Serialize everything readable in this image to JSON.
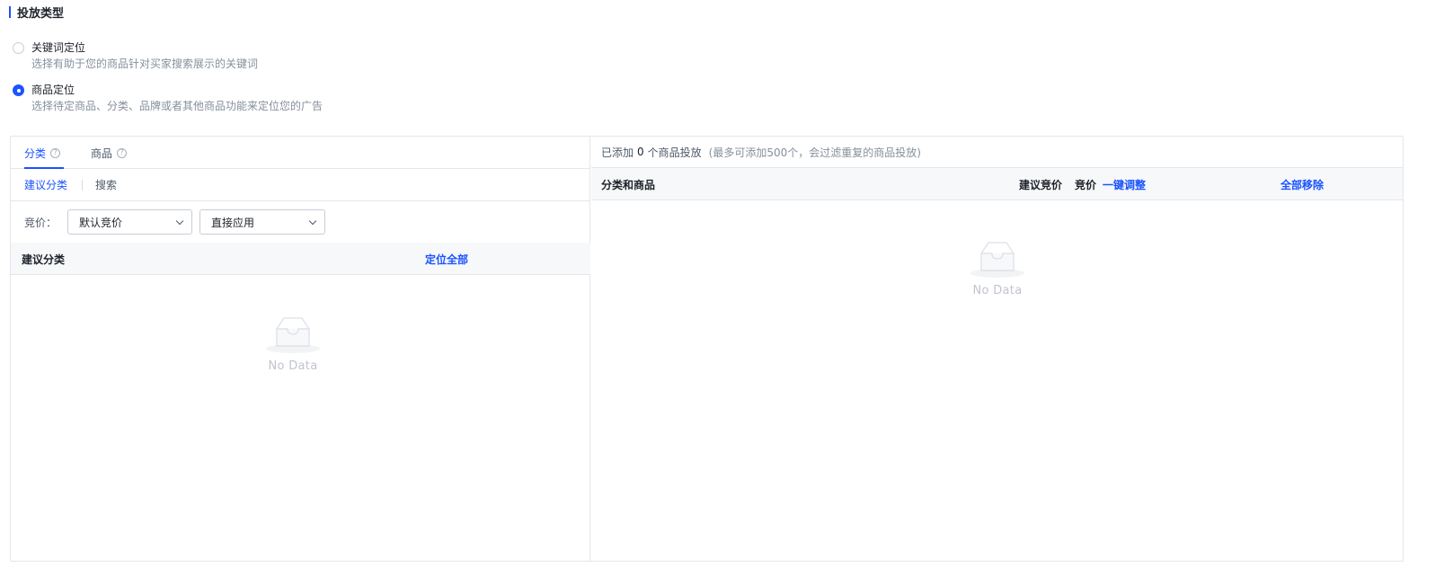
{
  "section": {
    "title": "投放类型"
  },
  "targeting_options": [
    {
      "label": "关键词定位",
      "desc": "选择有助于您的商品针对买家搜索展示的关键词",
      "checked": false
    },
    {
      "label": "商品定位",
      "desc": "选择待定商品、分类、品牌或者其他商品功能来定位您的广告",
      "checked": true
    }
  ],
  "left": {
    "tabs": [
      {
        "label": "分类",
        "help": "?",
        "active": true
      },
      {
        "label": "商品",
        "help": "?",
        "active": false
      }
    ],
    "subtabs": [
      {
        "label": "建议分类",
        "active": true
      },
      {
        "label": "搜索",
        "active": false
      }
    ],
    "bid_label": "竞价：",
    "bid_select": "默认竞价",
    "apply_select": "直接应用",
    "table": {
      "col_category": "建议分类",
      "col_action": "定位全部"
    },
    "empty_text": "No Data"
  },
  "right": {
    "added_prefix": "已添加",
    "added_count": "0",
    "added_suffix": "个商品投放",
    "hint": "(最多可添加500个，会过滤重复的商品投放)",
    "table": {
      "col_item": "分类和商品",
      "col_suggested_bid": "建议竞价",
      "col_bid": "竞价",
      "col_bulk_adjust": "一键调整",
      "col_remove_all": "全部移除"
    },
    "empty_text": "No Data"
  },
  "colors": {
    "accent": "#1a53ff",
    "border": "#e5e6eb",
    "header_bg": "#f7f8fa",
    "muted": "#86909c"
  }
}
